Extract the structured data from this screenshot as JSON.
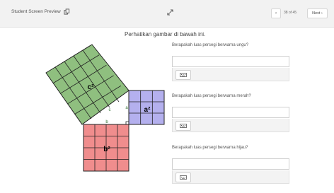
{
  "topbar": {
    "title": "Student Screen Preview",
    "page_indicator": "38 of 45",
    "prev_label": "‹",
    "next_label": "Next ›"
  },
  "instruction": "Perhatikan gambar di bawah ini.",
  "figure": {
    "label_c2": "c²",
    "label_a2": "a²",
    "label_b2": "b²",
    "side_a": "a",
    "side_b": "b",
    "side_c": "c",
    "colors": {
      "green": "#8fbf7f",
      "purple": "#b4b0ee",
      "red": "#f08d8d"
    }
  },
  "questions": [
    {
      "label": "Berapakah luas persegi berwarna ungu?",
      "value": ""
    },
    {
      "label": "Berapakah luas persegi berwarna merah?",
      "value": ""
    },
    {
      "label": "Berapakah luas persegi berwarna hijau?",
      "value": ""
    }
  ]
}
